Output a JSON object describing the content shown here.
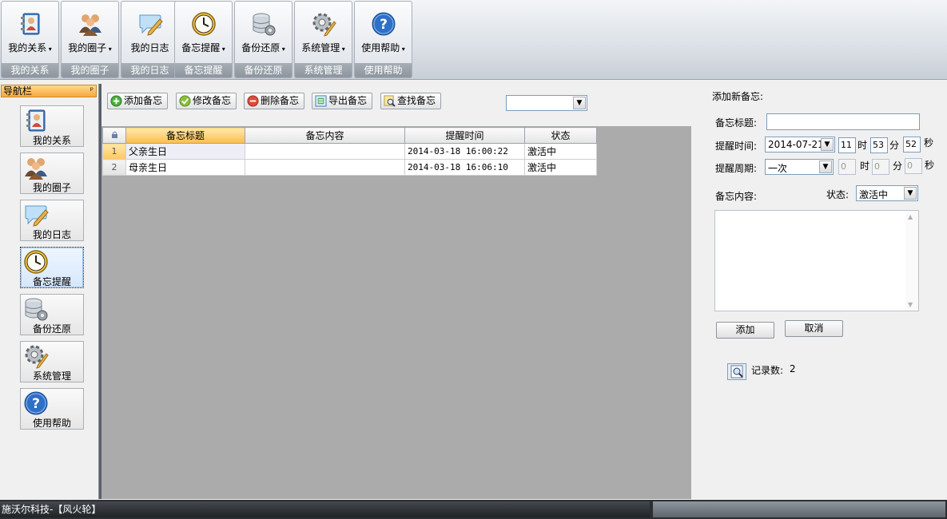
{
  "ribbon": {
    "groups": [
      {
        "label": "我的关系",
        "caption": "我的关系",
        "dropdown": true
      },
      {
        "label": "我的圈子",
        "caption": "我的圈子",
        "dropdown": true
      },
      {
        "label": "我的日志",
        "caption": "我的日志",
        "dropdown": false
      },
      {
        "label": "备忘提醒",
        "caption": "备忘提醒",
        "dropdown": true
      },
      {
        "label": "备份还原",
        "caption": "备份还原",
        "dropdown": true
      },
      {
        "label": "系统管理",
        "caption": "系统管理",
        "dropdown": true
      },
      {
        "label": "使用帮助",
        "caption": "使用帮助",
        "dropdown": true
      }
    ]
  },
  "nav": {
    "title": "导航栏",
    "pin": "ᵖ",
    "items": [
      {
        "label": "我的关系",
        "icon": "contacts-book-icon"
      },
      {
        "label": "我的圈子",
        "icon": "people-group-icon"
      },
      {
        "label": "我的日志",
        "icon": "speech-bubble-pen-icon"
      },
      {
        "label": "备忘提醒",
        "icon": "clock-icon",
        "active": true
      },
      {
        "label": "备份还原",
        "icon": "database-gear-icon"
      },
      {
        "label": "系统管理",
        "icon": "gear-pencil-icon"
      },
      {
        "label": "使用帮助",
        "icon": "help-icon"
      }
    ]
  },
  "toolbar": {
    "add": "添加备忘",
    "edit": "修改备忘",
    "delete": "删除备忘",
    "export": "导出备忘",
    "find": "查找备忘",
    "filter_value": ""
  },
  "grid": {
    "columns": [
      "备忘标题",
      "备忘内容",
      "提醒时间",
      "状态"
    ],
    "rows": [
      {
        "num": "1",
        "title": "父亲生日",
        "content": "",
        "time": "2014-03-18 16:00:22",
        "status": "激活中"
      },
      {
        "num": "2",
        "title": "母亲生日",
        "content": "",
        "time": "2014-03-18 16:06:10",
        "status": "激活中"
      }
    ]
  },
  "form": {
    "heading": "添加新备忘:",
    "title_label": "备忘标题:",
    "title_value": "",
    "time_label": "提醒时间:",
    "date_value": "2014-07-21",
    "hour_value": "11",
    "hour_unit": "时",
    "minute_value": "53",
    "minute_unit": "分",
    "second_value": "52",
    "second_unit": "秒",
    "cycle_label": "提醒周期:",
    "cycle_value": "一次",
    "cycle_hour": "0",
    "cycle_hour_unit": "时",
    "cycle_minute": "0",
    "cycle_minute_unit": "分",
    "cycle_second": "0",
    "cycle_second_unit": "秒",
    "content_label": "备忘内容:",
    "status_label": "状态:",
    "status_value": "激活中",
    "add_button": "添加",
    "cancel_button": "取消",
    "record_label": "记录数:",
    "record_count": "2"
  },
  "statusbar": {
    "text": "施沃尔科技-【风火轮】"
  }
}
